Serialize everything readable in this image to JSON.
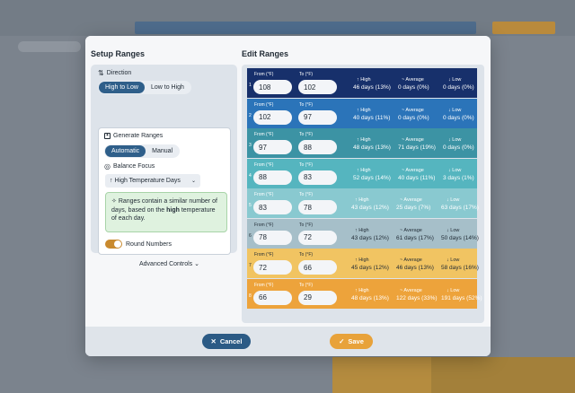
{
  "setup": {
    "title": "Setup Ranges",
    "direction_label": "Direction",
    "direction_options": [
      "High to Low",
      "Low to High"
    ],
    "generate_label": "Generate Ranges",
    "generate_options": [
      "Automatic",
      "Manual"
    ],
    "balance_label": "Balance Focus",
    "balance_value": "High Temperature Days",
    "info_pre": "Ranges contain a similar number of days, based on the ",
    "info_bold": "high",
    "info_post": " temperature of each day.",
    "round_label": "Round Numbers",
    "round_on": true,
    "advanced_label": "Advanced Controls"
  },
  "edit": {
    "title": "Edit Ranges",
    "from_label": "From (°F)",
    "to_label": "To (°F)",
    "high_label": "↑ High",
    "avg_label": "~ Average",
    "low_label": "↓ Low",
    "rows": [
      {
        "idx": "1",
        "from": "108",
        "to": "102",
        "high": "46 days (13%)",
        "avg": "0 days (0%)",
        "low": "0 days (0%)",
        "color": "#17306b",
        "text": "#ffffff"
      },
      {
        "idx": "2",
        "from": "102",
        "to": "97",
        "high": "40 days (11%)",
        "avg": "0 days (0%)",
        "low": "0 days (0%)",
        "color": "#2b74b9",
        "text": "#ffffff"
      },
      {
        "idx": "3",
        "from": "97",
        "to": "88",
        "high": "48 days (13%)",
        "avg": "71 days (19%)",
        "low": "0 days (0%)",
        "color": "#3c93a4",
        "text": "#ffffff"
      },
      {
        "idx": "4",
        "from": "88",
        "to": "83",
        "high": "52 days (14%)",
        "avg": "40 days (11%)",
        "low": "3 days (1%)",
        "color": "#55b5bf",
        "text": "#ffffff"
      },
      {
        "idx": "5",
        "from": "83",
        "to": "78",
        "high": "43 days (12%)",
        "avg": "25 days (7%)",
        "low": "63 days (17%)",
        "color": "#89c9d0",
        "text": "#ffffff"
      },
      {
        "idx": "6",
        "from": "78",
        "to": "72",
        "high": "43 days (12%)",
        "avg": "61 days (17%)",
        "low": "50 days (14%)",
        "color": "#a6bfc9",
        "text": "#1f2933"
      },
      {
        "idx": "7",
        "from": "72",
        "to": "66",
        "high": "45 days (12%)",
        "avg": "46 days (13%)",
        "low": "58 days (16%)",
        "color": "#f1c462",
        "text": "#1f2933"
      },
      {
        "idx": "8",
        "from": "66",
        "to": "29",
        "high": "48 days (13%)",
        "avg": "122 days (33%)",
        "low": "191 days (52%)",
        "color": "#eda33b",
        "text": "#ffffff"
      }
    ]
  },
  "footer": {
    "cancel_label": "Cancel",
    "save_label": "Save"
  },
  "colors": {
    "primary": "#2f5f8a",
    "save": "#e8a23a",
    "cancel": "#2b5a85"
  }
}
